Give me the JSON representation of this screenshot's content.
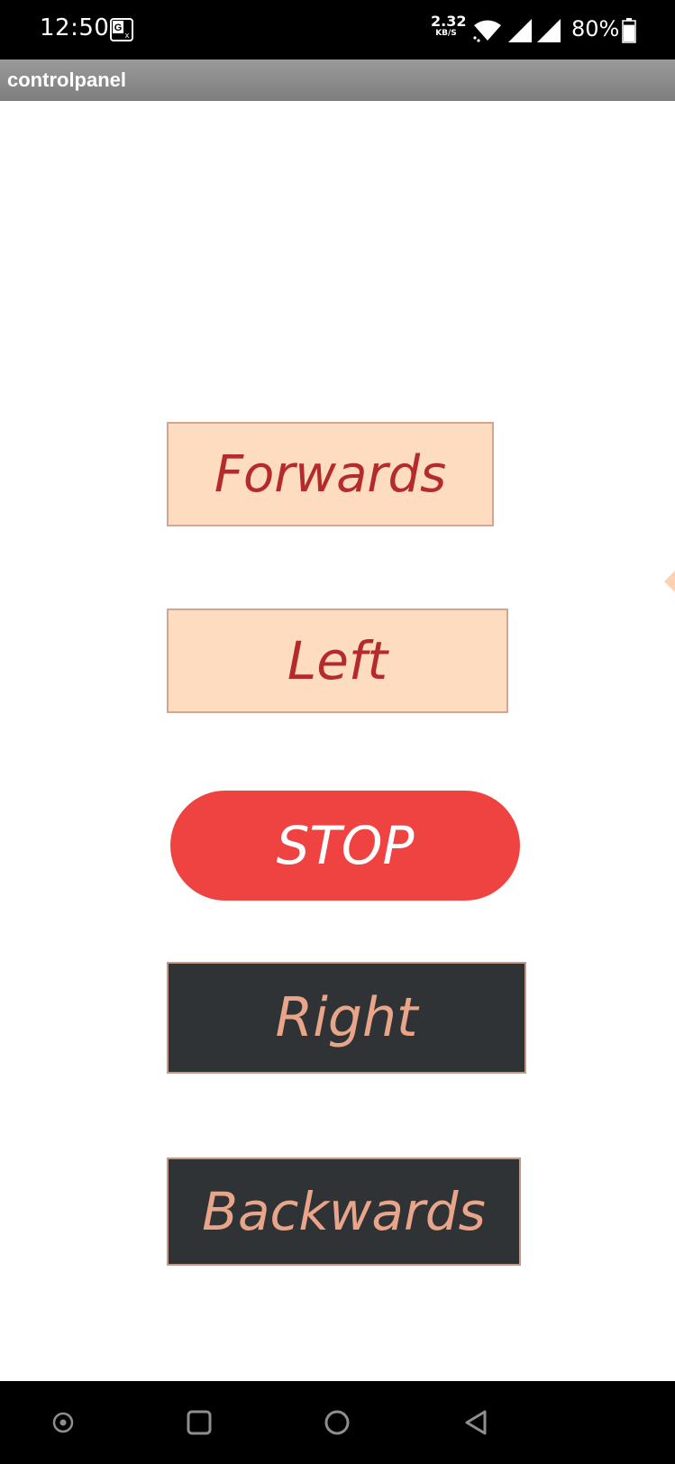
{
  "status_bar": {
    "time": "12:50",
    "net_speed_value": "2.32",
    "net_speed_unit": "KB/S",
    "battery_percent": "80%",
    "battery_level": 0.8,
    "icons": [
      "translate-icon",
      "wifi-icon",
      "signal-icon",
      "signal-icon",
      "battery-icon"
    ]
  },
  "app": {
    "title": "controlpanel"
  },
  "controls": {
    "forwards_label": "Forwards",
    "left_label": "Left",
    "stop_label": "STOP",
    "right_label": "Right",
    "backwards_label": "Backwards"
  },
  "nav_bar": {
    "icons": [
      "circle-dot-icon",
      "recents-square-icon",
      "home-circle-icon",
      "back-triangle-icon"
    ]
  },
  "colors": {
    "light_button_bg": "#fddcbf",
    "light_button_text": "#b52a2a",
    "stop_button_bg": "#ef4342",
    "dark_button_bg": "#2f3335",
    "dark_button_text": "#e9a58a",
    "title_bar_bg": "#8c8c8c"
  }
}
